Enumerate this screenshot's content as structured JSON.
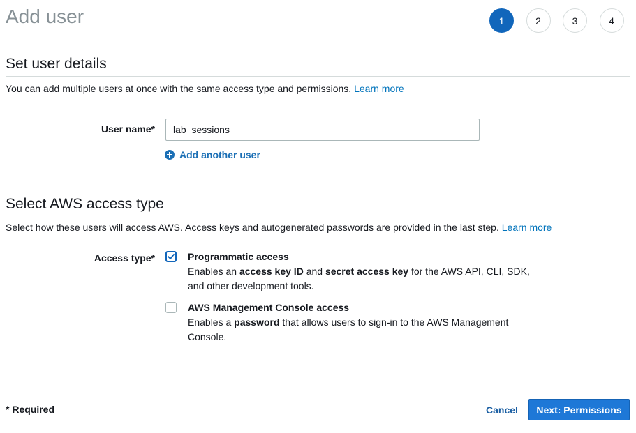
{
  "header": {
    "title": "Add user",
    "steps": [
      {
        "label": "1",
        "active": true
      },
      {
        "label": "2",
        "active": false
      },
      {
        "label": "3",
        "active": false
      },
      {
        "label": "4",
        "active": false
      }
    ]
  },
  "user_details": {
    "heading": "Set user details",
    "description": "You can add multiple users at once with the same access type and permissions.",
    "learn_more": "Learn more",
    "user_name_label": "User name*",
    "user_name_value": "lab_sessions",
    "add_another_user": "Add another user"
  },
  "access_type": {
    "heading": "Select AWS access type",
    "description": "Select how these users will access AWS. Access keys and autogenerated passwords are provided in the last step.",
    "learn_more": "Learn more",
    "label": "Access type*",
    "options": [
      {
        "title": "Programmatic access",
        "checked": true,
        "desc_parts": [
          "Enables an ",
          "access key ID",
          " and ",
          "secret access key",
          " for the AWS API, CLI, SDK, and other development tools."
        ]
      },
      {
        "title": "AWS Management Console access",
        "checked": false,
        "desc_parts": [
          "Enables a ",
          "password",
          " that allows users to sign-in to the AWS Management Console."
        ]
      }
    ]
  },
  "footer": {
    "required_note": "* Required",
    "cancel_label": "Cancel",
    "next_label": "Next: Permissions"
  },
  "colors": {
    "accent": "#1166bb",
    "link": "#0073bb",
    "primary_button": "#1e78d7"
  }
}
